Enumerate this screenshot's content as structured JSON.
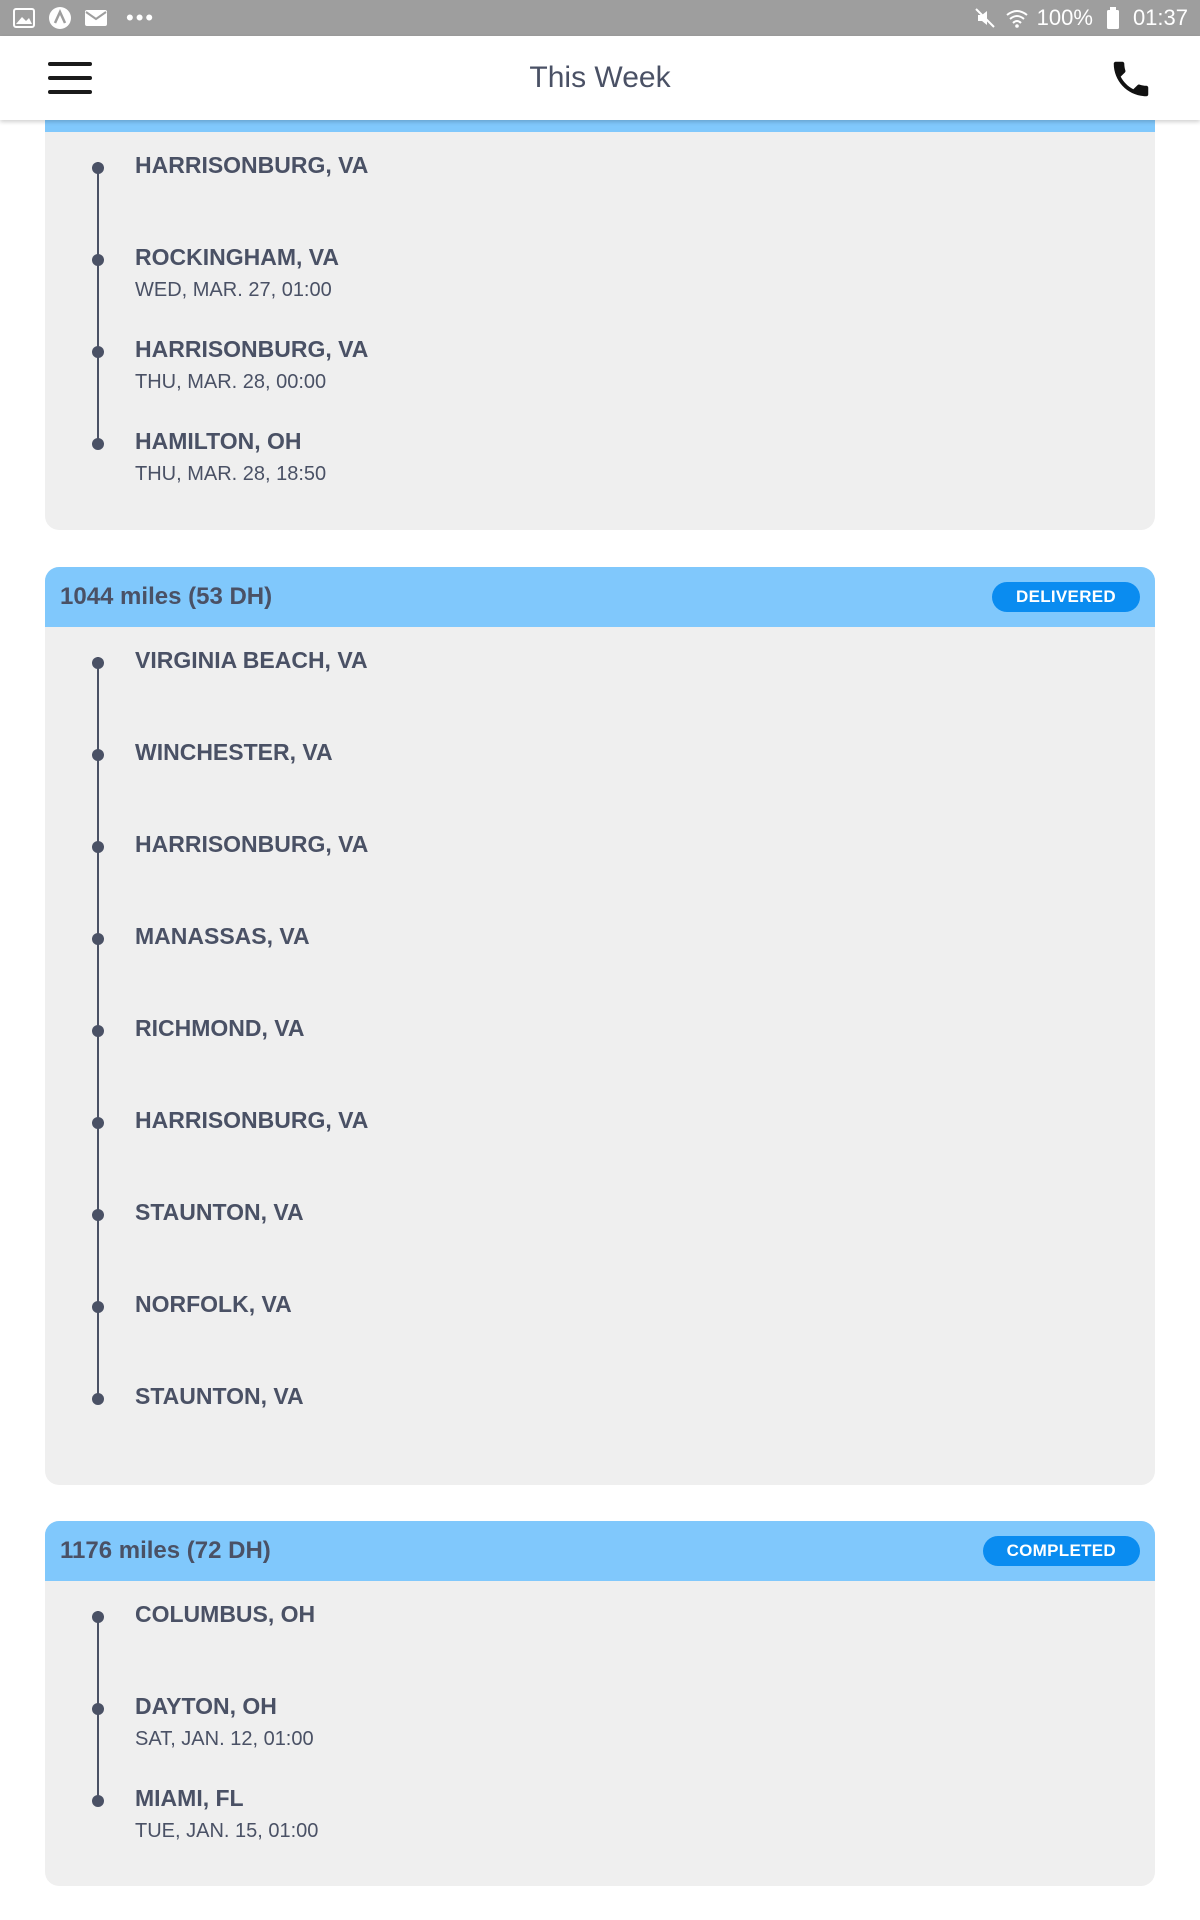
{
  "status_bar": {
    "battery": "100%",
    "time": "01:37"
  },
  "header": {
    "title": "This Week"
  },
  "cards": [
    {
      "stops": [
        {
          "city": "HARRISONBURG, VA",
          "time": ""
        },
        {
          "city": "ROCKINGHAM, VA",
          "time": "WED, MAR. 27, 01:00"
        },
        {
          "city": "HARRISONBURG, VA",
          "time": "THU, MAR. 28, 00:00"
        },
        {
          "city": "HAMILTON, OH",
          "time": "THU, MAR. 28, 18:50"
        }
      ]
    },
    {
      "title": "1044 miles (53 DH)",
      "status": "DELIVERED",
      "stops": [
        {
          "city": "VIRGINIA BEACH, VA",
          "time": ""
        },
        {
          "city": "WINCHESTER, VA",
          "time": ""
        },
        {
          "city": "HARRISONBURG, VA",
          "time": ""
        },
        {
          "city": "MANASSAS, VA",
          "time": ""
        },
        {
          "city": "RICHMOND, VA",
          "time": ""
        },
        {
          "city": "HARRISONBURG, VA",
          "time": ""
        },
        {
          "city": "STAUNTON, VA",
          "time": ""
        },
        {
          "city": "NORFOLK, VA",
          "time": ""
        },
        {
          "city": "STAUNTON, VA",
          "time": ""
        }
      ]
    },
    {
      "title": "1176 miles (72 DH)",
      "status": "COMPLETED",
      "stops": [
        {
          "city": "COLUMBUS, OH",
          "time": ""
        },
        {
          "city": "DAYTON, OH",
          "time": "SAT, JAN. 12, 01:00"
        },
        {
          "city": "MIAMI, FL",
          "time": "TUE, JAN. 15, 01:00"
        }
      ]
    }
  ]
}
